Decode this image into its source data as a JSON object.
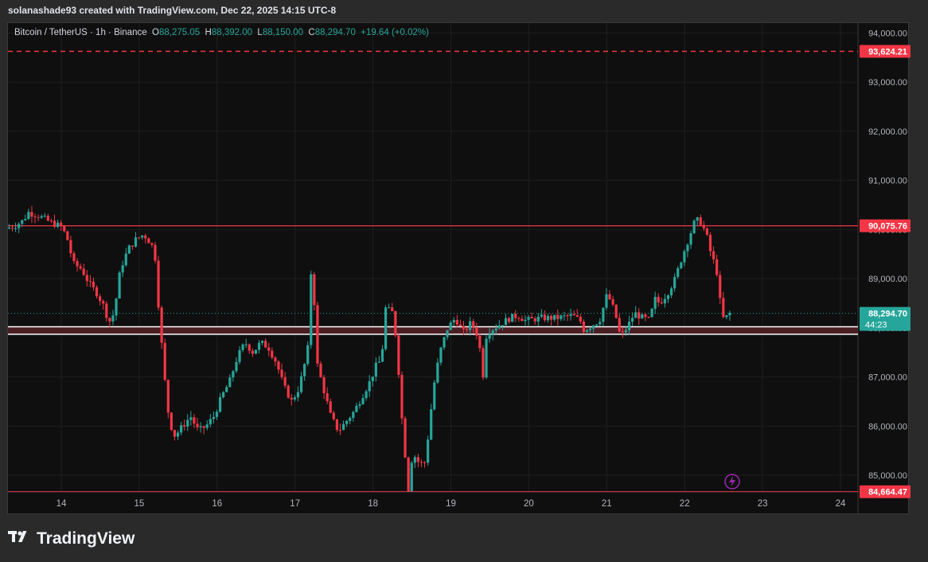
{
  "header": {
    "credit": "solanashade93 created with TradingView.com, Dec 22, 2025 14:15 UTC-8"
  },
  "legend": {
    "symbol": "Bitcoin / TetherUS · 1h · Binance",
    "o_label": "O",
    "o_value": "88,275.05",
    "h_label": "H",
    "h_value": "88,392.00",
    "l_label": "L",
    "l_value": "88,150.00",
    "c_label": "C",
    "c_value": "88,294.70",
    "change": "+19.64 (+0.02%)"
  },
  "footer": {
    "logo_text": "TradingView",
    "logo_icon": "tradingview-logo-icon"
  },
  "colors": {
    "up": "#26a69a",
    "down": "#f23645",
    "bg": "#0f0f0f",
    "grid": "#1f1f1f"
  },
  "chart_data": {
    "type": "candlestick",
    "symbol": "BTCUSDT",
    "timeframe": "1h",
    "y_ticks": [
      85000,
      86000,
      87000,
      88000,
      89000,
      90000,
      91000,
      92000,
      93000,
      94000
    ],
    "y_tick_labels": [
      "85,000.00",
      "86,000.00",
      "87,000.00",
      "88,000.00",
      "89,000.00",
      "90,000.00",
      "91,000.00",
      "92,000.00",
      "93,000.00",
      "94,000.00"
    ],
    "ylim": [
      84660,
      94200
    ],
    "x_ticks": [
      "14",
      "15",
      "16",
      "17",
      "18",
      "19",
      "20",
      "21",
      "22",
      "23",
      "24"
    ],
    "xlim": [
      13.33,
      24.05
    ],
    "grid": true,
    "horizontal_lines": [
      {
        "value": 93624.21,
        "label": "93,624.21",
        "style": "dashed",
        "color": "#f23645"
      },
      {
        "value": 90075.76,
        "label": "90,075.76",
        "style": "solid",
        "color": "#f23645"
      },
      {
        "value": 84664.47,
        "label": "84,664.47",
        "style": "solid",
        "color": "#f23645"
      }
    ],
    "zone": {
      "from": 87870,
      "to": 88020,
      "border_color": "#ffffff",
      "fill": "#4a1f24"
    },
    "last_price": {
      "value": 88294.7,
      "label": "88,294.70",
      "countdown": "44:23",
      "color": "#26a69a"
    },
    "path": [
      [
        13.33,
        90020
      ],
      [
        13.45,
        90080
      ],
      [
        13.55,
        90180
      ],
      [
        13.62,
        90350
      ],
      [
        13.75,
        90280
      ],
      [
        13.9,
        90150
      ],
      [
        14.05,
        90050
      ],
      [
        14.12,
        89800
      ],
      [
        14.2,
        89300
      ],
      [
        14.3,
        89200
      ],
      [
        14.4,
        88900
      ],
      [
        14.5,
        88700
      ],
      [
        14.6,
        88400
      ],
      [
        14.65,
        88100
      ],
      [
        14.72,
        88300
      ],
      [
        14.8,
        89200
      ],
      [
        14.9,
        89600
      ],
      [
        15.0,
        89800
      ],
      [
        15.1,
        89900
      ],
      [
        15.2,
        89700
      ],
      [
        15.25,
        89400
      ],
      [
        15.3,
        88200
      ],
      [
        15.35,
        87300
      ],
      [
        15.4,
        86400
      ],
      [
        15.45,
        86000
      ],
      [
        15.5,
        85800
      ],
      [
        15.6,
        86000
      ],
      [
        15.7,
        86200
      ],
      [
        15.8,
        85900
      ],
      [
        15.9,
        86000
      ],
      [
        16.0,
        86200
      ],
      [
        16.1,
        86600
      ],
      [
        16.2,
        86900
      ],
      [
        16.3,
        87400
      ],
      [
        16.4,
        87700
      ],
      [
        16.5,
        87500
      ],
      [
        16.6,
        87700
      ],
      [
        16.7,
        87600
      ],
      [
        16.8,
        87300
      ],
      [
        16.9,
        86800
      ],
      [
        17.0,
        86500
      ],
      [
        17.1,
        86800
      ],
      [
        17.15,
        87200
      ],
      [
        17.2,
        87400
      ],
      [
        17.26,
        89600
      ],
      [
        17.32,
        87300
      ],
      [
        17.4,
        86800
      ],
      [
        17.5,
        86200
      ],
      [
        17.6,
        85900
      ],
      [
        17.7,
        86100
      ],
      [
        17.8,
        86300
      ],
      [
        17.9,
        86600
      ],
      [
        18.0,
        86900
      ],
      [
        18.1,
        87300
      ],
      [
        18.15,
        87300
      ],
      [
        18.2,
        88400
      ],
      [
        18.3,
        88300
      ],
      [
        18.35,
        87600
      ],
      [
        18.42,
        86000
      ],
      [
        18.5,
        84670
      ],
      [
        18.55,
        85500
      ],
      [
        18.6,
        85300
      ],
      [
        18.7,
        85200
      ],
      [
        18.75,
        85800
      ],
      [
        18.82,
        86800
      ],
      [
        18.9,
        87500
      ],
      [
        19.0,
        88000
      ],
      [
        19.1,
        88200
      ],
      [
        19.2,
        87900
      ],
      [
        19.3,
        88100
      ],
      [
        19.4,
        87800
      ],
      [
        19.45,
        86950
      ],
      [
        19.5,
        87900
      ],
      [
        19.6,
        88000
      ],
      [
        19.7,
        88100
      ],
      [
        19.8,
        88200
      ],
      [
        19.9,
        88250
      ],
      [
        20.0,
        88150
      ],
      [
        20.2,
        88200
      ],
      [
        20.4,
        88200
      ],
      [
        20.6,
        88250
      ],
      [
        20.7,
        88150
      ],
      [
        20.75,
        87950
      ],
      [
        20.85,
        88050
      ],
      [
        20.95,
        88150
      ],
      [
        21.05,
        88700
      ],
      [
        21.15,
        88300
      ],
      [
        21.22,
        87800
      ],
      [
        21.3,
        88000
      ],
      [
        21.4,
        88300
      ],
      [
        21.5,
        88200
      ],
      [
        21.6,
        88150
      ],
      [
        21.65,
        88600
      ],
      [
        21.72,
        88500
      ],
      [
        21.82,
        88700
      ],
      [
        21.92,
        89000
      ],
      [
        22.0,
        89400
      ],
      [
        22.1,
        89850
      ],
      [
        22.18,
        90200
      ],
      [
        22.25,
        90150
      ],
      [
        22.32,
        89900
      ],
      [
        22.38,
        89500
      ],
      [
        22.45,
        89200
      ],
      [
        22.5,
        88500
      ],
      [
        22.55,
        88100
      ],
      [
        22.6,
        88300
      ],
      [
        22.62,
        88294.7
      ]
    ]
  }
}
